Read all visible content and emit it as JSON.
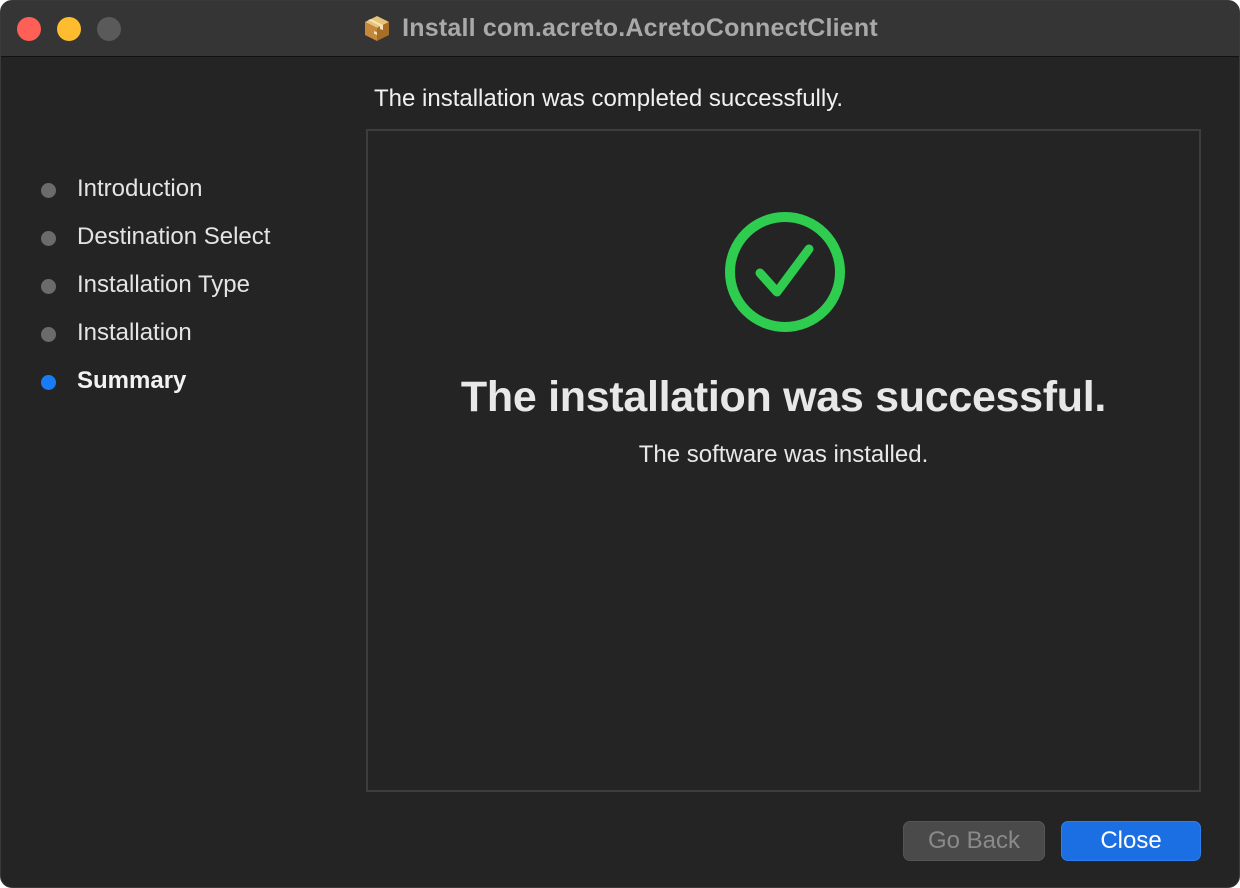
{
  "window": {
    "title": "Install com.acreto.AcretoConnectClient",
    "title_icon": "package-icon"
  },
  "header": {
    "text": "The installation was completed successfully."
  },
  "sidebar": {
    "steps": [
      {
        "label": "Introduction",
        "active": false
      },
      {
        "label": "Destination Select",
        "active": false
      },
      {
        "label": "Installation Type",
        "active": false
      },
      {
        "label": "Installation",
        "active": false
      },
      {
        "label": "Summary",
        "active": true
      }
    ]
  },
  "content": {
    "icon": "checkmark-circle-icon",
    "title": "The installation was successful.",
    "subtitle": "The software was installed."
  },
  "buttons": {
    "back_label": "Go Back",
    "close_label": "Close"
  },
  "colors": {
    "accent": "#1a7cf5",
    "success": "#2ecc4f",
    "close_light": "#fe5f57",
    "minimize_light": "#febc2e"
  }
}
